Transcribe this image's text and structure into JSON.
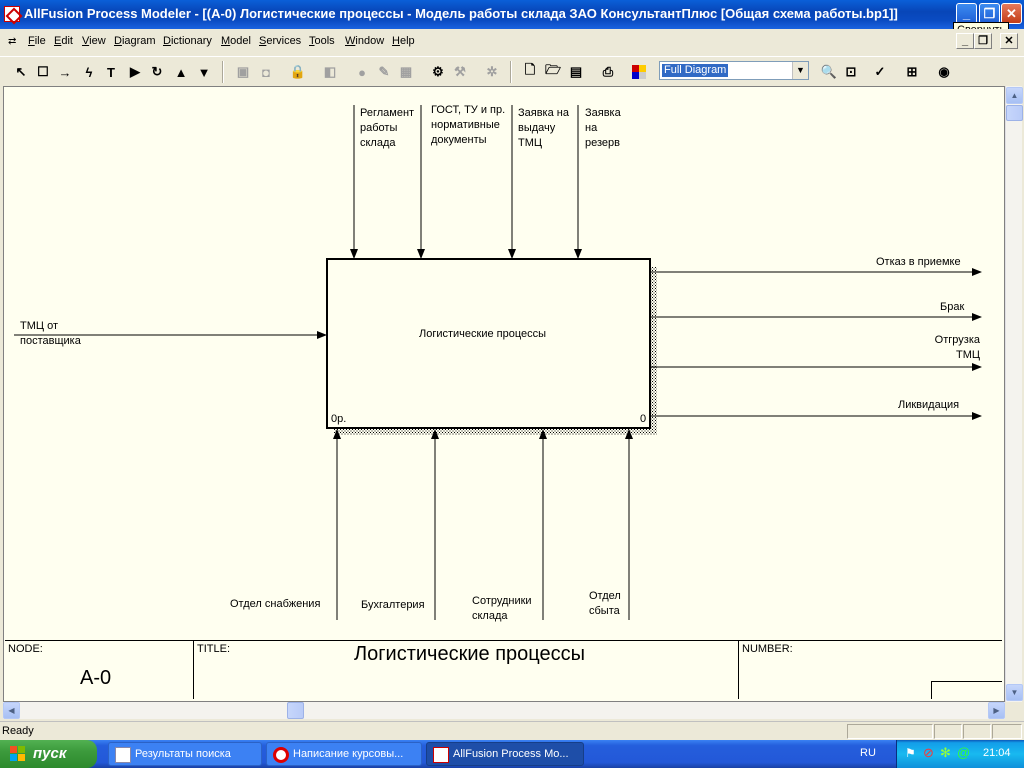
{
  "window": {
    "title": "AllFusion Process Modeler - [(A-0) Логистические процессы   - Модель работы склада ЗАО КонсультантПлюс  [Общая схема работы.bp1]]",
    "tooltip": "Свернуть"
  },
  "menu": [
    "File",
    "Edit",
    "View",
    "Diagram",
    "Dictionary",
    "Model",
    "Services",
    "Tools",
    "Window",
    "Help"
  ],
  "toolbar": {
    "diagram_view": "Full Diagram"
  },
  "diagram": {
    "activity": {
      "name": "Логистические процессы",
      "cost": "0р.",
      "number": "0"
    },
    "inputs": [
      {
        "label": "ТМЦ от\nпоставщика"
      }
    ],
    "controls": [
      {
        "label": "Регламент\nработы\nсклада"
      },
      {
        "label": "ГОСТ, ТУ и пр.\nнормативные\nдокументы"
      },
      {
        "label": "Заявка на\nвыдачу\nТМЦ"
      },
      {
        "label": "Заявка\nна\nрезерв"
      }
    ],
    "outputs": [
      {
        "label": "Отказ в приемке"
      },
      {
        "label": "Брак"
      },
      {
        "label": "Отгрузка\nТМЦ"
      },
      {
        "label": "Ликвидация"
      }
    ],
    "mechanisms": [
      {
        "label": "Отдел снабжения"
      },
      {
        "label": "Бухгалтерия"
      },
      {
        "label": "Сотрудники\nсклада"
      },
      {
        "label": "Отдел\nсбыта"
      }
    ],
    "frame": {
      "node_caption": "NODE:",
      "node_value": "A-0",
      "title_caption": "TITLE:",
      "title_value": "Логистические процессы",
      "number_caption": "NUMBER:",
      "number_value": ""
    }
  },
  "status": {
    "text": "Ready"
  },
  "taskbar": {
    "start_label": "пуск",
    "tasks": [
      "Результаты поиска",
      "Написание курсовы...",
      "AllFusion Process Mo..."
    ],
    "language": "RU",
    "clock": "21:04"
  }
}
